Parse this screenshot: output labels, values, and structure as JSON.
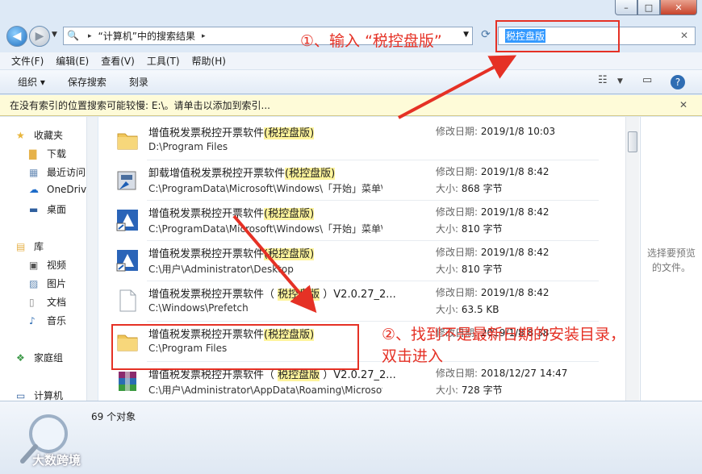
{
  "window": {
    "minimize_icon": "–",
    "maximize_icon": "□",
    "close_icon": "✕"
  },
  "address": {
    "crumbs": [
      "“计算机”中的搜索结果"
    ],
    "search_value": "税控盘版"
  },
  "annotations": {
    "step1": "①、输入 “税控盘版”",
    "step2_line1": "②、找到不是最新日期的安装目录，",
    "step2_line2": "双击进入"
  },
  "menu": [
    "文件(F)",
    "编辑(E)",
    "查看(V)",
    "工具(T)",
    "帮助(H)"
  ],
  "toolbar": {
    "organize": "组织 ▾",
    "save_search": "保存搜索",
    "burn": "刻录"
  },
  "infobar": {
    "text": "在没有索引的位置搜索可能较慢: E:\\。请单击以添加到索引..."
  },
  "nav": {
    "favorites": "收藏夹",
    "favorites_items": [
      "下载",
      "最近访问的",
      "OneDrive",
      "桌面"
    ],
    "library": "库",
    "library_items": [
      "视频",
      "图片",
      "文档",
      "音乐"
    ],
    "homegroup": "家庭组",
    "computer": "计算机"
  },
  "results": [
    {
      "name_pre": "增值税发票税控开票软件",
      "name_hl": "(税控盘版)",
      "name_post": "",
      "path": "D:\\Program Files",
      "m1_label": "修改日期: ",
      "m1_value": "2019/1/8 10:03",
      "m2_label": "",
      "m2_value": "",
      "icon": "folder-icon"
    },
    {
      "name_pre": "卸载增值税发票税控开票软件",
      "name_hl": "(税控盘版)",
      "name_post": "",
      "path": "C:\\ProgramData\\Microsoft\\Windows\\「开始」菜单\\程序\\...",
      "m1_label": "修改日期: ",
      "m1_value": "2019/1/8 8:42",
      "m2_label": "大小: ",
      "m2_value": "868 字节",
      "icon": "uninstall-icon"
    },
    {
      "name_pre": "增值税发票税控开票软件",
      "name_hl": "(税控盘版)",
      "name_post": "",
      "path": "C:\\ProgramData\\Microsoft\\Windows\\「开始」菜单\\程序\\...",
      "m1_label": "修改日期: ",
      "m1_value": "2019/1/8 8:42",
      "m2_label": "大小: ",
      "m2_value": "810 字节",
      "icon": "app-shortcut-icon"
    },
    {
      "name_pre": "增值税发票税控开票软件",
      "name_hl": "(税控盘版)",
      "name_post": "",
      "path": "C:\\用户\\Administrator\\Desktop",
      "m1_label": "修改日期: ",
      "m1_value": "2019/1/8 8:42",
      "m2_label": "大小: ",
      "m2_value": "810 字节",
      "icon": "app-shortcut-icon"
    },
    {
      "name_pre": "增值税发票税控开票软件（ ",
      "name_hl": "税控盘版",
      "name_post": " ）V2.0.27_2...",
      "path": "C:\\Windows\\Prefetch",
      "m1_label": "修改日期: ",
      "m1_value": "2019/1/8 8:42",
      "m2_label": "大小: ",
      "m2_value": "63.5 KB",
      "icon": "blank-file-icon"
    },
    {
      "name_pre": "增值税发票税控开票软件",
      "name_hl": "(税控盘版)",
      "name_post": "",
      "path": "C:\\Program Files",
      "m1_label": "修改日期: ",
      "m1_value": "2019/1/8 8:38",
      "m2_label": "",
      "m2_value": "",
      "icon": "folder-icon"
    },
    {
      "name_pre": "增值税发票税控开票软件（ ",
      "name_hl": "税控盘版",
      "name_post": " ）V2.0.27_2...",
      "path": "C:\\用户\\Administrator\\AppData\\Roaming\\Microsoft\\Wind...",
      "m1_label": "修改日期: ",
      "m1_value": "2018/12/27 14:47",
      "m2_label": "大小: ",
      "m2_value": "728 字节",
      "icon": "winrar-icon"
    }
  ],
  "preview": {
    "text": "选择要预览的文件。"
  },
  "status": {
    "count": "69 个对象"
  },
  "watermark": "大数跨境"
}
